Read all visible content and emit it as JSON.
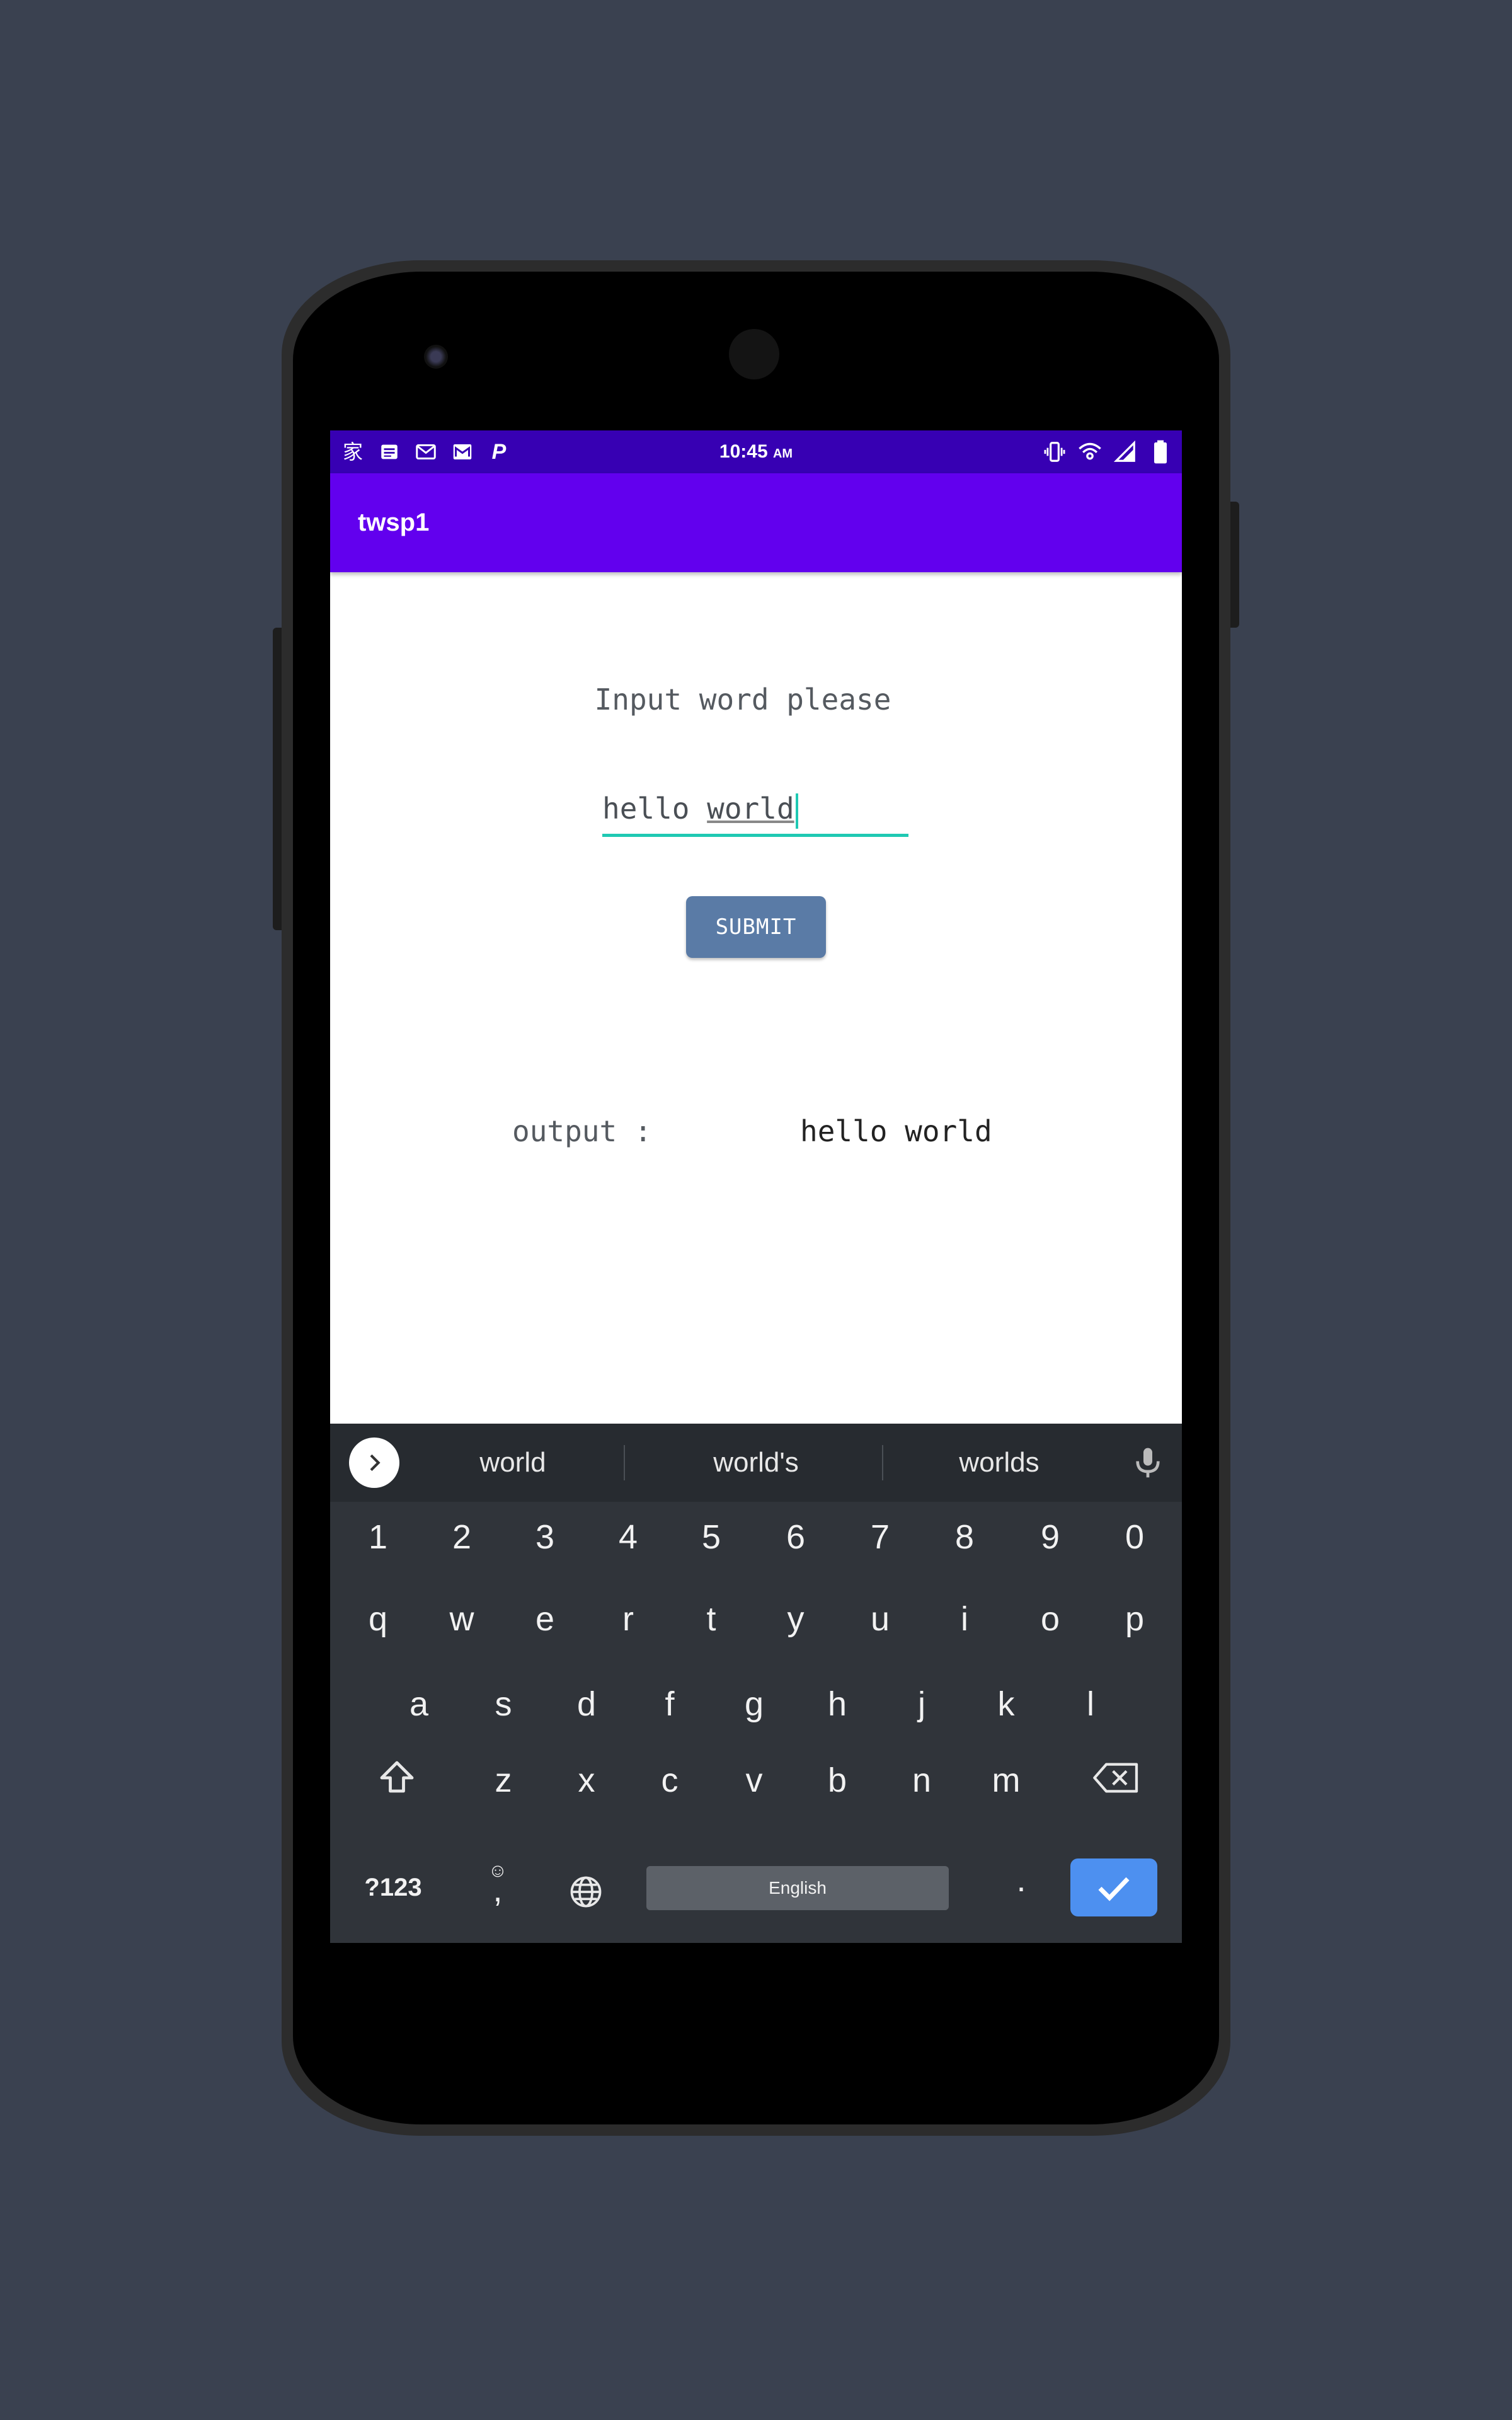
{
  "status_bar": {
    "time": "10:45",
    "ampm": "AM",
    "left_icons": [
      "kanji-notification-icon",
      "news-icon",
      "mail-icon",
      "gmail-icon",
      "parking-icon"
    ],
    "right_icons": [
      "vibrate-icon",
      "wifi-icon",
      "signal-icon",
      "battery-icon"
    ]
  },
  "app_bar": {
    "title": "twsp1"
  },
  "main": {
    "prompt": "Input word please",
    "input_value_plain": "hello ",
    "input_value_underlined": "world",
    "submit_label": "SUBMIT",
    "output_label": "output :",
    "output_value": "hello world"
  },
  "keyboard": {
    "suggestions": [
      "world",
      "world's",
      "worlds"
    ],
    "number_row": [
      "1",
      "2",
      "3",
      "4",
      "5",
      "6",
      "7",
      "8",
      "9",
      "0"
    ],
    "row1": [
      "q",
      "w",
      "e",
      "r",
      "t",
      "y",
      "u",
      "i",
      "o",
      "p"
    ],
    "row2": [
      "a",
      "s",
      "d",
      "f",
      "g",
      "h",
      "j",
      "k",
      "l"
    ],
    "row3": [
      "z",
      "x",
      "c",
      "v",
      "b",
      "n",
      "m"
    ],
    "symbols_key": "?123",
    "comma_key": ",",
    "period_key": ".",
    "space_label": "English"
  },
  "colors": {
    "status_bar": "#3700b3",
    "app_bar": "#6200ee",
    "accent": "#1fc9b3",
    "button": "#5a7ba6",
    "keyboard_bg": "#30343a",
    "enter_key": "#4d90f0",
    "page_bg": "#3a4150"
  }
}
